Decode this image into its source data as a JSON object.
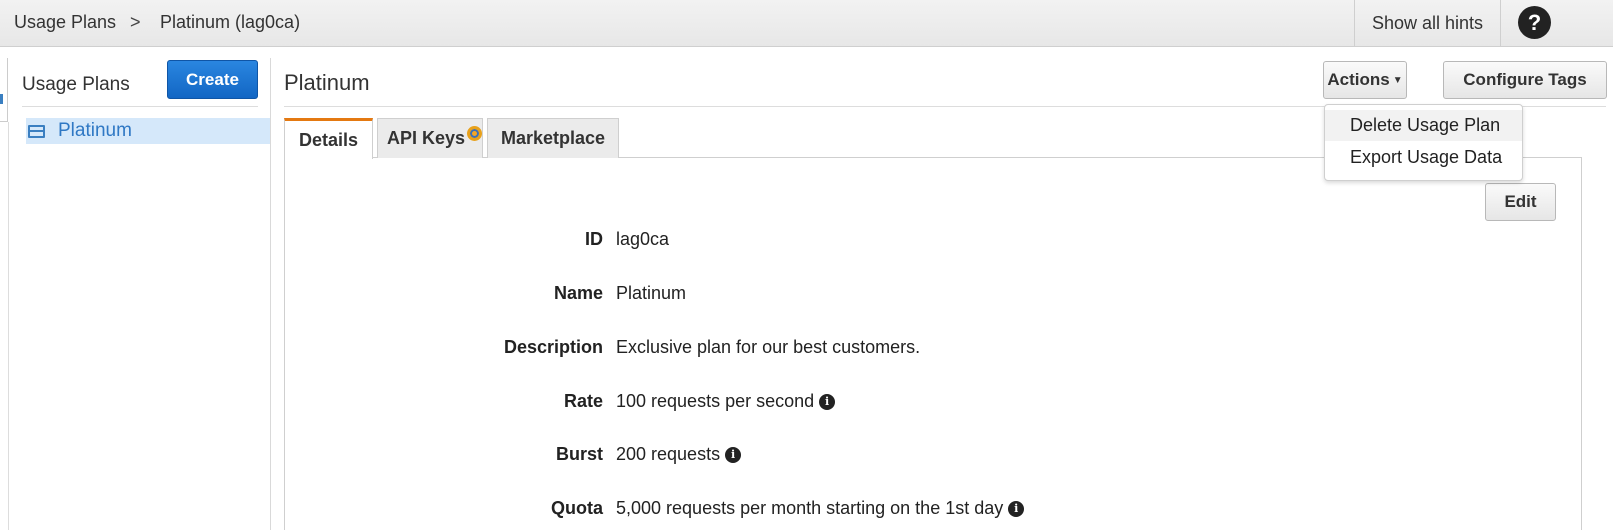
{
  "breadcrumb": {
    "root": "Usage Plans",
    "separator": ">",
    "current": "Platinum (lag0ca)"
  },
  "header": {
    "hints_label": "Show all hints",
    "help_icon": "?"
  },
  "sidebar": {
    "title": "Usage Plans",
    "create_label": "Create",
    "items": [
      {
        "label": "Platinum",
        "icon": "card-icon",
        "selected": true
      }
    ]
  },
  "main": {
    "title": "Platinum",
    "actions_label": "Actions",
    "configure_tags_label": "Configure Tags",
    "actions_menu": [
      "Delete Usage Plan",
      "Export Usage Data"
    ],
    "tabs": [
      {
        "label": "Details",
        "active": true
      },
      {
        "label": "API Keys"
      },
      {
        "label": "Marketplace"
      }
    ],
    "edit_label": "Edit",
    "details": [
      {
        "label": "ID",
        "value": "lag0ca"
      },
      {
        "label": "Name",
        "value": "Platinum"
      },
      {
        "label": "Description",
        "value": "Exclusive plan for our best customers."
      },
      {
        "label": "Rate",
        "value": "100 requests per second",
        "info": true
      },
      {
        "label": "Burst",
        "value": "200 requests",
        "info": true
      },
      {
        "label": "Quota",
        "value": "5,000 requests per month starting on the 1st day",
        "info": true
      }
    ]
  },
  "colors": {
    "accent_blue": "#1a73d1",
    "tab_accent": "#e47911",
    "selected_bg": "#d5e8fa"
  }
}
